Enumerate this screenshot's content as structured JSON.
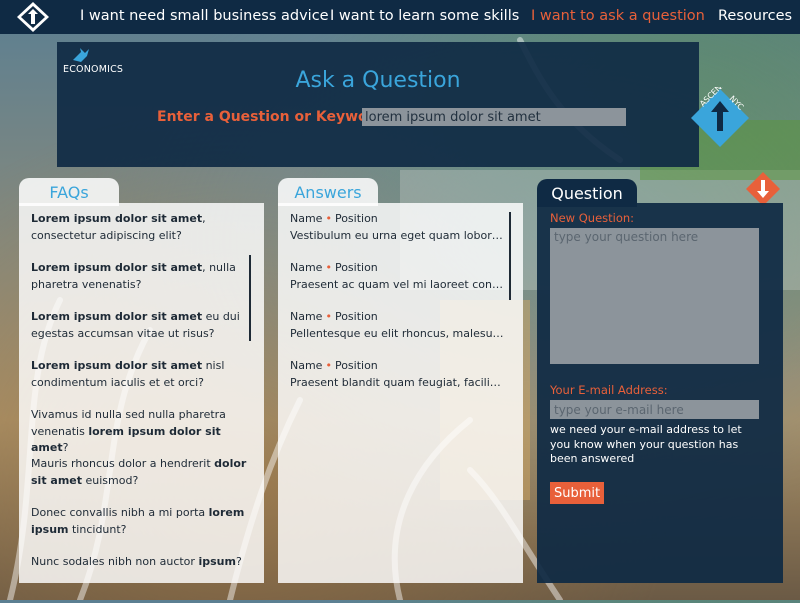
{
  "nav": {
    "items": [
      {
        "label": "I want need small business advice",
        "active": false
      },
      {
        "label": "I want to learn some skills",
        "active": false
      },
      {
        "label": "I want to ask a question",
        "active": true
      },
      {
        "label": "Resources",
        "active": false
      }
    ]
  },
  "header": {
    "brand": "ECONOMICS",
    "title": "Ask a Question",
    "keyword_label": "Enter a Question or Keyword:",
    "keyword_value": "lorem ipsum dolor sit amet",
    "ascend_logo_top": "ASCEND",
    "ascend_logo_side": "NYC"
  },
  "faqs": {
    "tab": "FAQs",
    "items": [
      {
        "bold": "Lorem ipsum dolor sit amet",
        "rest": ", consectetur adipiscing elit?"
      },
      {
        "bold": "Lorem ipsum dolor sit amet",
        "rest": ", nulla pharetra venenatis?"
      },
      {
        "bold": "Lorem ipsum dolor sit amet",
        "rest": " eu dui egestas accumsan vitae ut risus?"
      },
      {
        "bold": "Lorem ipsum dolor sit amet",
        "rest": " nisl condimentum iaculis et et orci?"
      },
      {
        "pre": "Vivamus id nulla sed nulla pharetra venenatis ",
        "bold": "lorem ipsum dolor sit amet",
        "rest": "?"
      },
      {
        "pre": "Mauris rhoncus dolor a hendrerit ",
        "bold": "dolor sit amet",
        "rest": " euismod?"
      },
      {
        "pre": "Donec convallis nibh a mi porta ",
        "bold": "lorem ipsum",
        "rest": " tincidunt?"
      },
      {
        "pre": "Nunc sodales nibh non auctor ",
        "bold": "ipsum",
        "rest": "?"
      }
    ]
  },
  "answers": {
    "tab": "Answers",
    "items": [
      {
        "name": "Name",
        "position": "Position",
        "snippet": "Vestibulum eu urna eget quam lobortis"
      },
      {
        "name": "Name",
        "position": "Position",
        "snippet": "Praesent ac quam vel mi laoreet congue"
      },
      {
        "name": "Name",
        "position": "Position",
        "snippet": "Pellentesque eu elit rhoncus, malesuada"
      },
      {
        "name": "Name",
        "position": "Position",
        "snippet": "Praesent blandit quam feugiat, facilisis"
      }
    ]
  },
  "question": {
    "tab": "Question",
    "new_label": "New Question:",
    "new_placeholder": "type your question here",
    "email_label": "Your E-mail Address:",
    "email_placeholder": "type your e-mail here",
    "email_note": "we need your e-mail address to let you know when your question has been answered",
    "submit_label": "Submit"
  },
  "colors": {
    "navy": "#0f2a44",
    "accent_orange": "#e8603a",
    "accent_blue": "#3aa5db",
    "field_gray": "#8c949b"
  }
}
